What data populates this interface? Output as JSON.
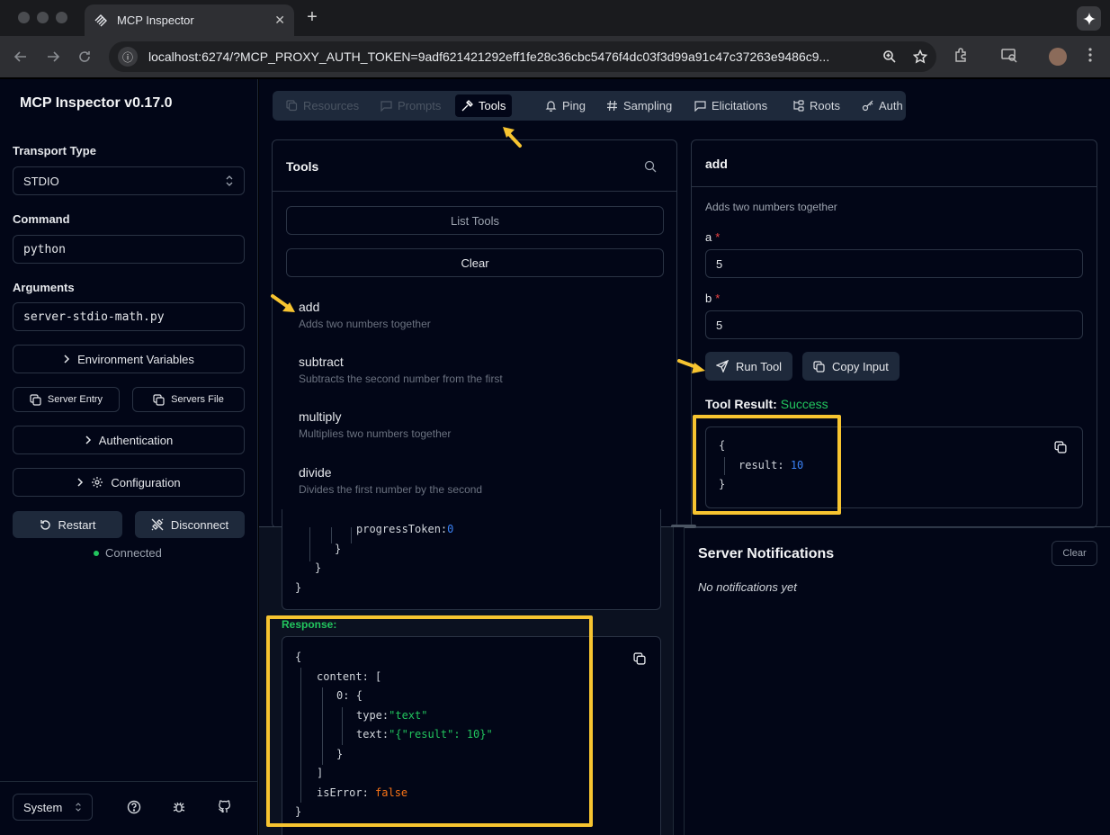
{
  "browser": {
    "tab_title": "MCP Inspector",
    "url_host": "localhost",
    "url_rest": ":6274/?MCP_PROXY_AUTH_TOKEN=9adf621421292eff1fe28c36cbc5476f4dc03f3d99a91c47c37263e9486c9..."
  },
  "sidebar": {
    "title": "MCP Inspector v0.17.0",
    "transport_label": "Transport Type",
    "transport_value": "STDIO",
    "command_label": "Command",
    "command_value": "python",
    "arguments_label": "Arguments",
    "arguments_value": "server-stdio-math.py",
    "env_button": "Environment Variables",
    "server_entry": "Server Entry",
    "servers_file": "Servers File",
    "auth_button": "Authentication",
    "config_button": "Configuration",
    "restart": "Restart",
    "disconnect": "Disconnect",
    "status": "Connected",
    "theme": "System"
  },
  "tabs": [
    "Resources",
    "Prompts",
    "Tools",
    "Ping",
    "Sampling",
    "Elicitations",
    "Roots",
    "Auth"
  ],
  "tools_panel": {
    "title": "Tools",
    "list_button": "List Tools",
    "clear_button": "Clear",
    "tools": [
      {
        "name": "add",
        "desc": "Adds two numbers together"
      },
      {
        "name": "subtract",
        "desc": "Subtracts the second number from the first"
      },
      {
        "name": "multiply",
        "desc": "Multiplies two numbers together"
      },
      {
        "name": "divide",
        "desc": "Divides the first number by the second"
      }
    ]
  },
  "detail": {
    "title": "add",
    "desc": "Adds two numbers together",
    "a_label": "a",
    "a_value": "5",
    "b_label": "b",
    "b_value": "5",
    "required_mark": "*",
    "run_button": "Run Tool",
    "copy_button": "Copy Input",
    "result_label": "Tool Result:",
    "result_status": "Success",
    "result_key": "result:",
    "result_val": "10"
  },
  "history": {
    "progress_key": "progressToken:",
    "progress_val": "0",
    "response_label": "Response:",
    "content_key": "content:",
    "index_key": "0:",
    "type_key": "type:",
    "type_val": "\"text\"",
    "text_key": "text:",
    "text_val": "\"{\"result\": 10}\"",
    "iserror_key": "isError:",
    "iserror_val": "false"
  },
  "notifications": {
    "title": "Server Notifications",
    "clear": "Clear",
    "empty": "No notifications yet"
  },
  "colors": {
    "highlight": "#f7c430",
    "success": "#22c55e",
    "bg": "#020617"
  }
}
